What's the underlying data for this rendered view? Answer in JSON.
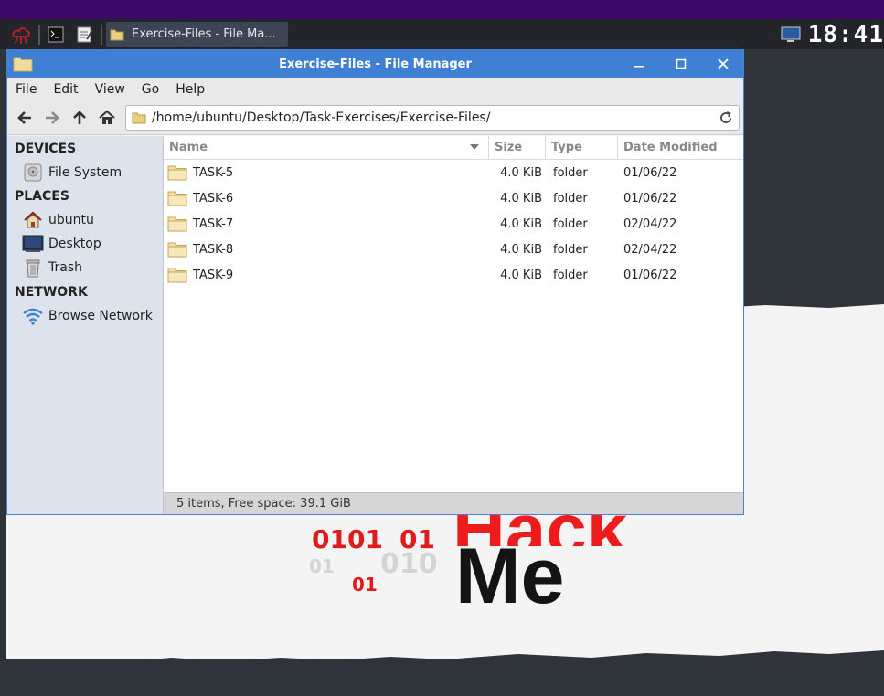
{
  "panel": {
    "task_title": "Exercise-Files - File Ma...",
    "clock": "18:41"
  },
  "wallpaper": {
    "bin_a": "0101",
    "bin_b": "01",
    "bin_c": "01",
    "bin_d": "010",
    "bin_e": "01",
    "hack": "Hack",
    "me": "Me",
    "colors": {
      "red": "#ee1c1c",
      "dark": "#141414"
    }
  },
  "window": {
    "title": "Exercise-Files - File Manager",
    "menu": [
      "File",
      "Edit",
      "View",
      "Go",
      "Help"
    ],
    "location": "/home/ubuntu/Desktop/Task-Exercises/Exercise-Files/",
    "sidebar": {
      "devices_header": "DEVICES",
      "places_header": "PLACES",
      "network_header": "NETWORK",
      "items": {
        "filesystem": "File System",
        "ubuntu": "ubuntu",
        "desktop": "Desktop",
        "trash": "Trash",
        "browse": "Browse Network"
      }
    },
    "columns": {
      "name": "Name",
      "size": "Size",
      "type": "Type",
      "date": "Date Modified"
    },
    "rows": [
      {
        "name": "TASK-5",
        "size": "4.0 KiB",
        "type": "folder",
        "date": "01/06/22"
      },
      {
        "name": "TASK-6",
        "size": "4.0 KiB",
        "type": "folder",
        "date": "01/06/22"
      },
      {
        "name": "TASK-7",
        "size": "4.0 KiB",
        "type": "folder",
        "date": "02/04/22"
      },
      {
        "name": "TASK-8",
        "size": "4.0 KiB",
        "type": "folder",
        "date": "02/04/22"
      },
      {
        "name": "TASK-9",
        "size": "4.0 KiB",
        "type": "folder",
        "date": "01/06/22"
      }
    ],
    "status": "5 items, Free space: 39.1 GiB",
    "accent_color": "#3f7fd4"
  }
}
